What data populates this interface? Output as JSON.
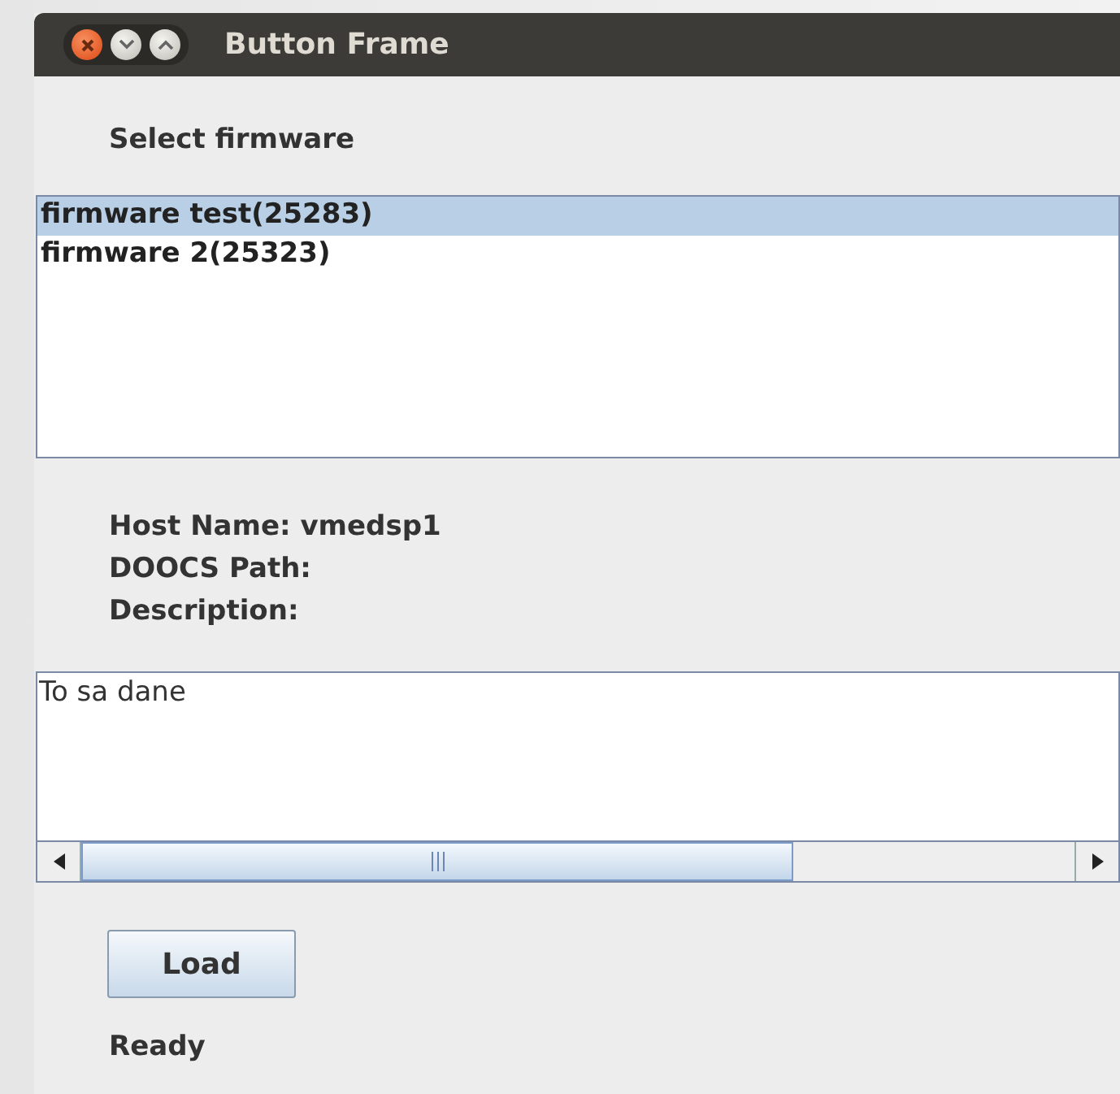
{
  "window": {
    "title": "Button Frame"
  },
  "firmware_label": "Select firmware",
  "firmware_list": [
    {
      "label": "firmware test(25283)",
      "selected": true
    },
    {
      "label": "firmware 2(25323)",
      "selected": false
    }
  ],
  "info": [
    "Host Name: vmedsp1",
    "DOOCS Path:",
    "Description:"
  ],
  "description_field": {
    "value": "To sa dane"
  },
  "load_button": "Load",
  "status": "Ready"
}
